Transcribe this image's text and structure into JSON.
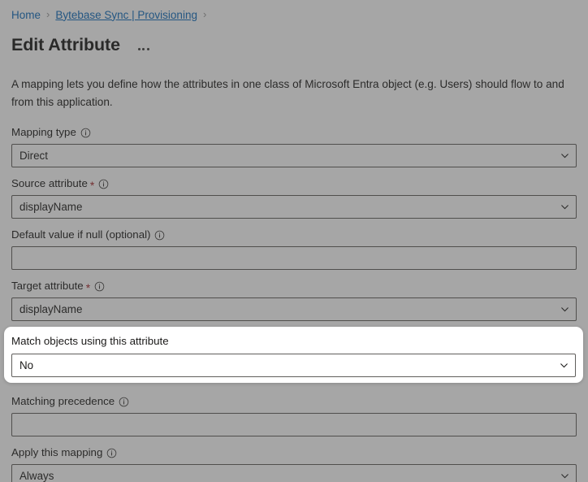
{
  "breadcrumb": {
    "items": [
      {
        "label": "Home",
        "hovered": false
      },
      {
        "label": "Bytebase Sync | Provisioning",
        "hovered": true
      }
    ],
    "separator": "›"
  },
  "header": {
    "title": "Edit Attribute",
    "overflow_menu": "more-actions"
  },
  "description": "A mapping lets you define how the attributes in one class of Microsoft Entra object (e.g. Users) should flow to and from this application.",
  "form": {
    "mapping_type": {
      "label": "Mapping type",
      "value": "Direct",
      "required": false,
      "has_info": true
    },
    "source_attribute": {
      "label": "Source attribute",
      "value": "displayName",
      "required": true,
      "required_marker": "*",
      "has_info": true
    },
    "default_value": {
      "label": "Default value if null (optional)",
      "value": "",
      "placeholder": "",
      "required": false,
      "has_info": true
    },
    "target_attribute": {
      "label": "Target attribute",
      "value": "displayName",
      "required": true,
      "required_marker": "*",
      "has_info": true
    },
    "match_objects": {
      "label": "Match objects using this attribute",
      "value": "No",
      "required": false,
      "has_info": false,
      "highlighted": true
    },
    "matching_precedence": {
      "label": "Matching precedence",
      "value": "",
      "placeholder": "",
      "required": false,
      "has_info": true
    },
    "apply_mapping": {
      "label": "Apply this mapping",
      "value": "Always",
      "required": false,
      "has_info": true
    }
  },
  "icons": {
    "info": "info-circle-icon",
    "chevron_down": "chevron-down-icon",
    "breadcrumb_chevron": "chevron-right-icon",
    "ellipsis": "ellipsis-horizontal-icon"
  },
  "colors": {
    "link": "#0f6cbd",
    "text": "#1b1a19",
    "required_star": "#a4262c",
    "field_border": "#605e5c",
    "scrim": "#3d3d3d",
    "spotlight_bg": "#ffffff"
  }
}
